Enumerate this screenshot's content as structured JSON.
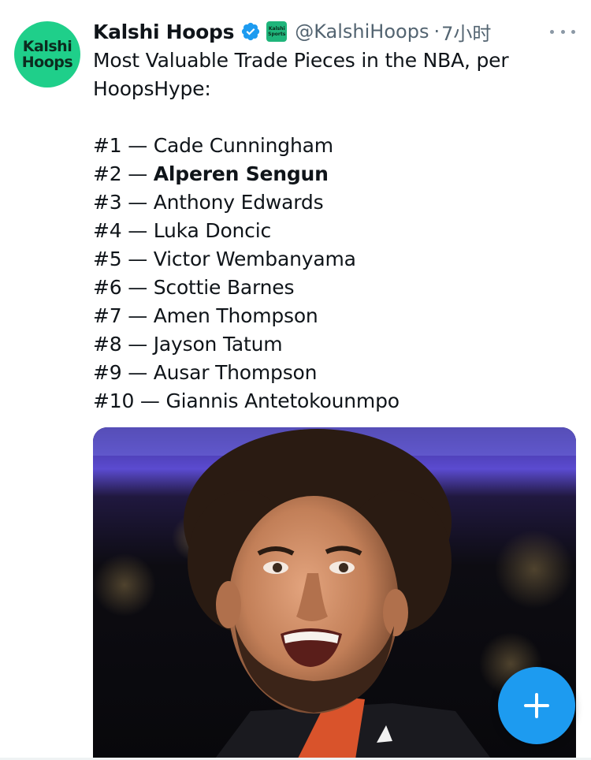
{
  "tweet": {
    "author": {
      "avatar_text_line1": "Kalshi",
      "avatar_text_line2": "Hoops",
      "display_name": "Kalshi Hoops",
      "affiliate_badge_line1": "Kalshi",
      "affiliate_badge_line2": "Sports",
      "handle": "@KalshiHoops",
      "separator": "·",
      "timestamp": "7小时",
      "verified_color": "#1d9bf0"
    },
    "text_intro_line1": "Most Valuable Trade Pieces in the NBA, per",
    "text_intro_line2": "HoopsHype:",
    "rankings": [
      {
        "rank": "#1 —",
        "player": "Cade Cunningham"
      },
      {
        "rank": "#2 —",
        "player": "Alperen Sengun"
      },
      {
        "rank": "#3 —",
        "player": "Anthony Edwards"
      },
      {
        "rank": "#4 —",
        "player": "Luka Doncic"
      },
      {
        "rank": "#5 —",
        "player": "Victor Wembanyama"
      },
      {
        "rank": "#6 —",
        "player": "Scottie Barnes"
      },
      {
        "rank": "#7 —",
        "player": "Amen Thompson"
      },
      {
        "rank": "#8 —",
        "player": "Jayson Tatum"
      },
      {
        "rank": "#9 —",
        "player": "Ausar Thompson"
      },
      {
        "rank": "#10 —",
        "player": "Giannis Antetokounmpo"
      }
    ],
    "media": {
      "type": "photo",
      "subject": "smiling basketball player with curly hair and beard"
    }
  },
  "ui": {
    "more_icon": "ellipsis-icon",
    "compose_icon": "plus-icon",
    "accent_color": "#1d9bf0",
    "brand_color": "#1fcf8a"
  }
}
